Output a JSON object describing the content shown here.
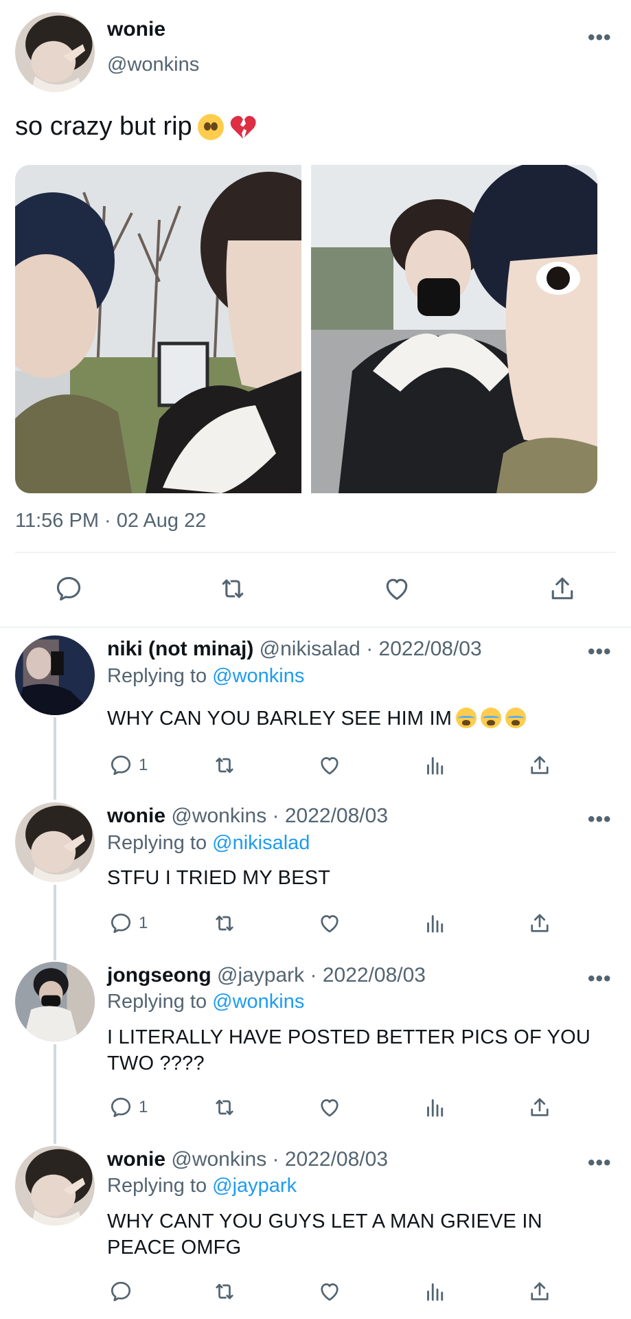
{
  "main_tweet": {
    "name": "wonie",
    "handle": "@wonkins",
    "text": "so crazy but rip",
    "emojis": [
      "pleading-face-icon",
      "broken-heart-icon"
    ],
    "timestamp": "11:56 PM · 02 Aug 22",
    "more": "•••"
  },
  "replies": [
    {
      "name": "niki (not minaj)",
      "meta": "@nikisalad · 2022/08/03",
      "replying_prefix": "Replying to ",
      "replying_to": "@wonkins",
      "text": "WHY CAN YOU BARLEY SEE HIM IM",
      "reply_count": "1",
      "more": "•••"
    },
    {
      "name": "wonie",
      "meta": "@wonkins · 2022/08/03",
      "replying_prefix": "Replying to ",
      "replying_to": "@nikisalad",
      "text": "STFU I TRIED MY BEST",
      "reply_count": "1",
      "more": "•••"
    },
    {
      "name": "jongseong",
      "meta": "@jaypark · 2022/08/03",
      "replying_prefix": "Replying to ",
      "replying_to": "@wonkins",
      "text": "I LITERALLY HAVE POSTED BETTER PICS OF YOU TWO ????",
      "reply_count": "1",
      "more": "•••"
    },
    {
      "name": "wonie",
      "meta": "@wonkins · 2022/08/03",
      "replying_prefix": "Replying to ",
      "replying_to": "@jaypark",
      "text": "WHY CANT YOU GUYS LET A MAN GRIEVE IN PEACE OMFG",
      "reply_count": "",
      "more": "•••"
    }
  ],
  "colors": {
    "text": "#0f1419",
    "secondary": "#536471",
    "link": "#1d9bf0",
    "divider": "#eff3f4"
  }
}
